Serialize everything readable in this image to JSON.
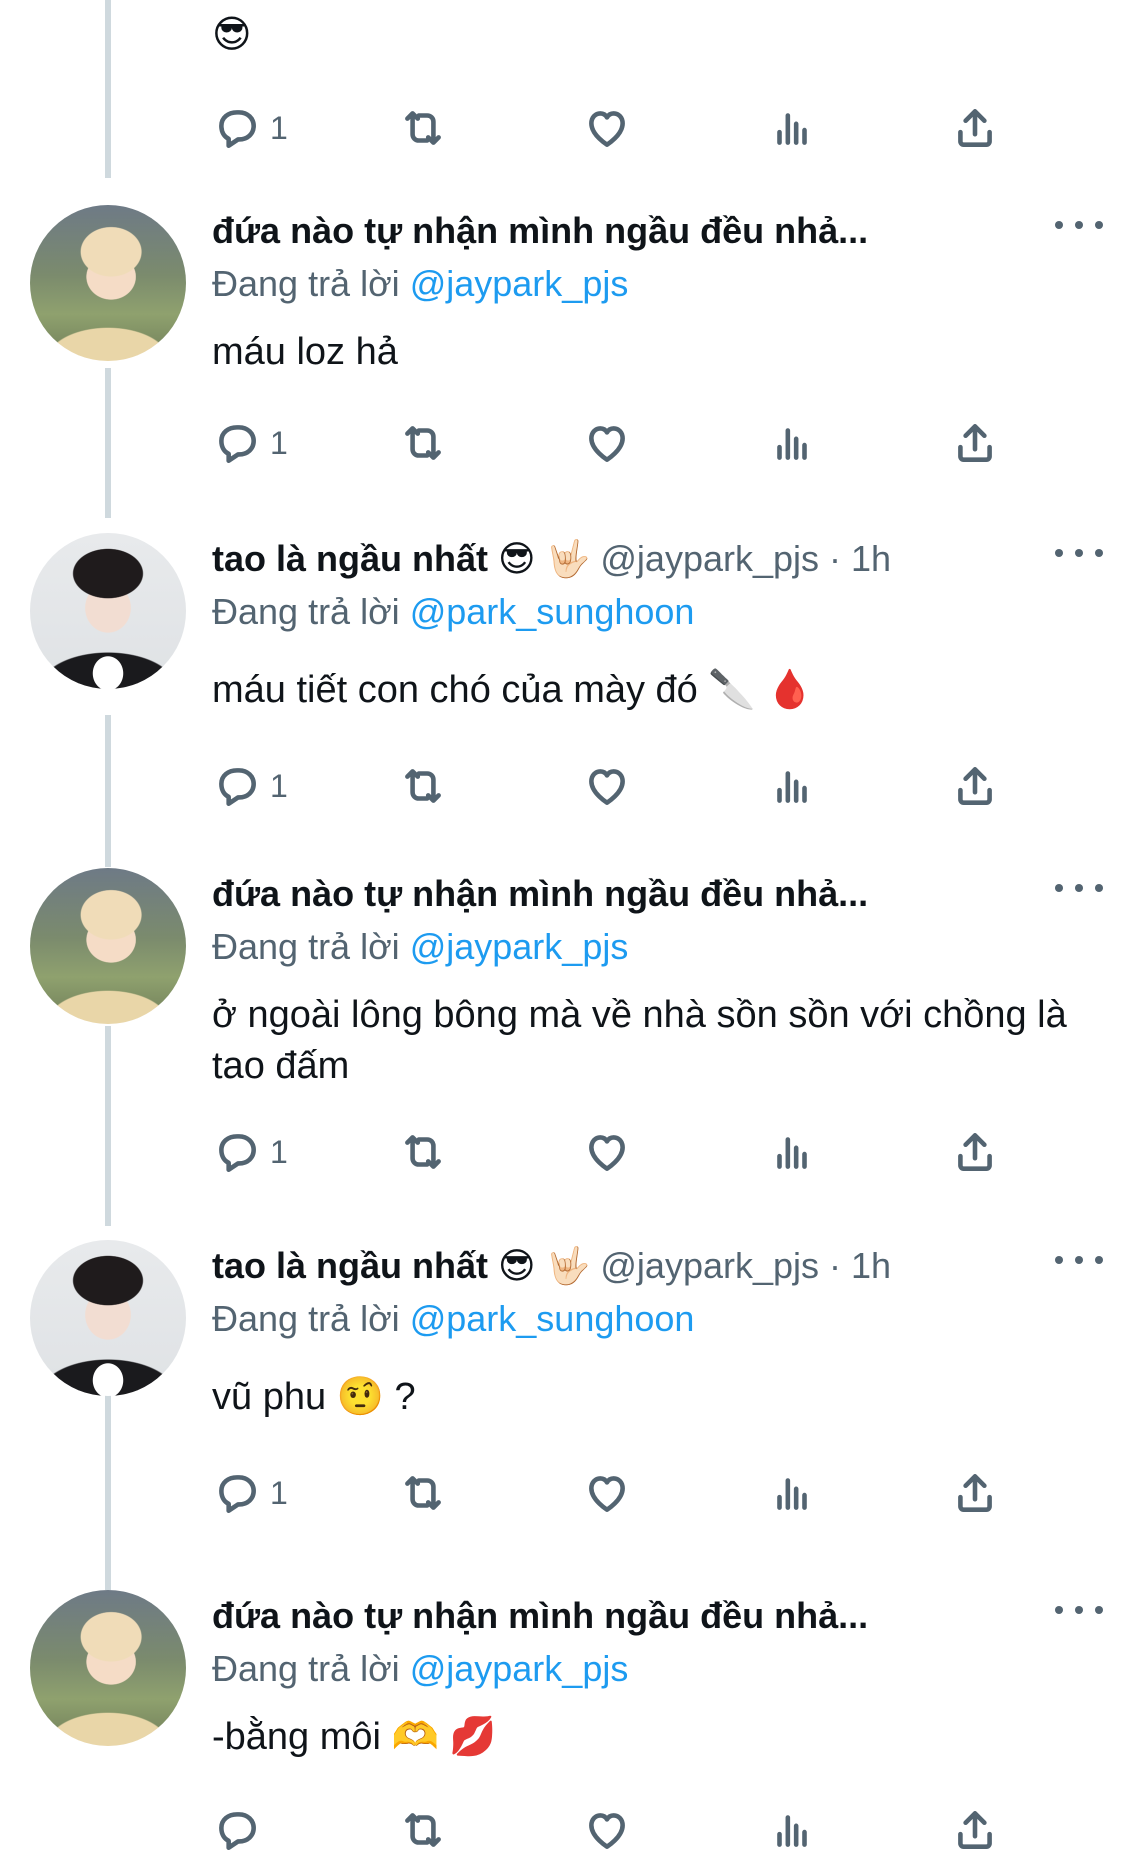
{
  "top_body": {
    "text": "😎"
  },
  "top_actions": {
    "reply_count": "1"
  },
  "tweets": [
    {
      "name": "đứa nào tự nhận mình ngầu đều nhả...",
      "handle_time": "",
      "replying_label": "Đang trả lời",
      "mention": "@jaypark_pjs",
      "body": "máu loz hả",
      "reply_count": "1"
    },
    {
      "name": "tao là ngầu nhất 😎 🤟🏻",
      "handle_time": "@jaypark_pjs · 1h",
      "replying_label": "Đang trả lời",
      "mention": "@park_sunghoon",
      "body": "máu tiết con chó của mày đó 🔪 🩸",
      "reply_count": "1"
    },
    {
      "name": "đứa nào tự nhận mình ngầu đều nhả...",
      "handle_time": "",
      "replying_label": "Đang trả lời",
      "mention": "@jaypark_pjs",
      "body": "ở ngoài lông bông mà về nhà sồn sồn với chồng là tao đấm",
      "reply_count": "1"
    },
    {
      "name": "tao là ngầu nhất 😎 🤟🏻",
      "handle_time": "@jaypark_pjs · 1h",
      "replying_label": "Đang trả lời",
      "mention": "@park_sunghoon",
      "body": "vũ phu 🤨 ?",
      "reply_count": "1"
    },
    {
      "name": "đứa nào tự nhận mình ngầu đều nhả...",
      "handle_time": "",
      "replying_label": "Đang trả lời",
      "mention": "@jaypark_pjs",
      "body": "-bằng môi 🫶 💋",
      "reply_count": ""
    }
  ],
  "icons": {
    "reply": "reply-icon",
    "retweet": "retweet-icon",
    "like": "heart-icon",
    "views": "views-icon",
    "share": "share-icon",
    "more": "more-icon"
  },
  "colors": {
    "text": "#0f1419",
    "secondary": "#536471",
    "link": "#1d9bf0",
    "thread_line": "#cfd9de"
  }
}
